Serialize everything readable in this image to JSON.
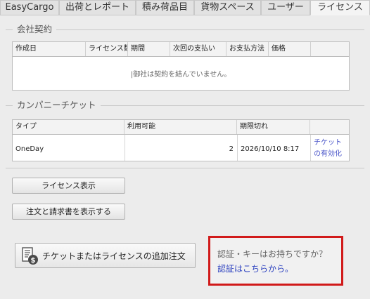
{
  "tabs": [
    {
      "label": "EasyCargo",
      "active": false
    },
    {
      "label": "出荷とレポート",
      "active": false
    },
    {
      "label": "積み荷品目",
      "active": false
    },
    {
      "label": "貨物スペース",
      "active": false
    },
    {
      "label": "ユーザー",
      "active": false
    },
    {
      "label": "ライセンス",
      "active": true
    }
  ],
  "contract": {
    "title": "会社契約",
    "columns": [
      "作成日",
      "ライセンス数",
      "期間",
      "次回の支払い",
      "お支払方法",
      "価格"
    ],
    "empty_message": "|御社は契約を結んでいません。"
  },
  "tickets": {
    "title": "カンパニーチケット",
    "columns": [
      "タイプ",
      "利用可能",
      "期限切れ"
    ],
    "rows": [
      {
        "type": "OneDay",
        "available": "2",
        "expires": "2026/10/10 8:17",
        "action": "チケットの有効化"
      }
    ]
  },
  "buttons": {
    "show_license": "ライセンス表示",
    "show_orders": "注文と請求書を表示する",
    "additional_order": "チケットまたはライセンスの追加注文"
  },
  "auth": {
    "question": "認証・キーはお持ちですか？",
    "link": "認証はこちらから。"
  },
  "colors": {
    "highlight_border": "#d11a1a",
    "link": "#2a3fbf"
  },
  "icons": {
    "order_button_icon": "invoice-dollar-icon"
  }
}
